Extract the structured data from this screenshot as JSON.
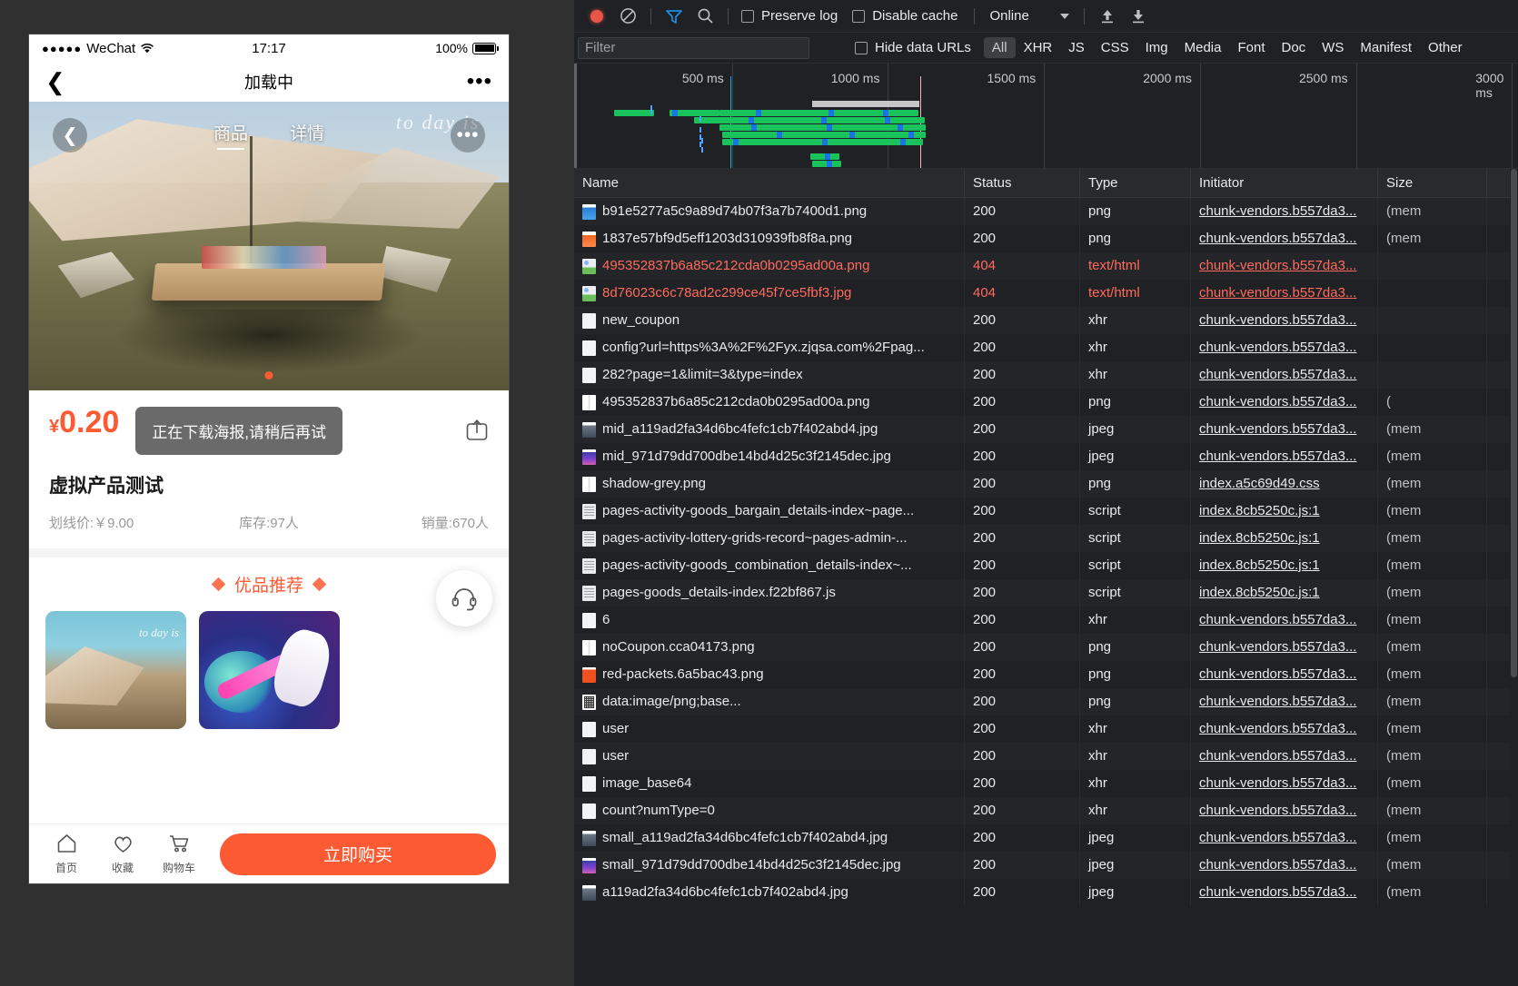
{
  "phone": {
    "status_bar": {
      "signal_dots": "●●●●●",
      "carrier": "WeChat",
      "wifi_icon": "wifi-icon",
      "time": "17:17",
      "battery_percent": "100%"
    },
    "nav": {
      "back_icon": "chevron-left-icon",
      "title": "加载中",
      "more_icon": "more-horizontal-icon"
    },
    "hero": {
      "back_icon": "chevron-left-icon",
      "more_icon": "more-horizontal-icon",
      "tabs": [
        {
          "label": "商品",
          "active": true
        },
        {
          "label": "详情",
          "active": false
        }
      ],
      "watermark": "to day is"
    },
    "product": {
      "currency": "¥",
      "price": "0.20",
      "toast": "正在下载海报,请稍后再试",
      "share_icon": "share-icon",
      "title": "虚拟产品测试",
      "original_price_label": "划线价:￥9.00",
      "stock_label": "库存:97人",
      "sales_label": "销量:670人"
    },
    "recommend": {
      "heading": "优品推荐",
      "diamond_icon": "diamond-icon",
      "service_icon": "headset-icon",
      "card_1_caption": "to day is"
    },
    "bottom": {
      "nav": [
        {
          "icon": "home-icon",
          "label": "首页"
        },
        {
          "icon": "heart-icon",
          "label": "收藏"
        },
        {
          "icon": "cart-icon",
          "label": "购物车"
        }
      ],
      "buy_label": "立即购买"
    }
  },
  "devtools": {
    "toolbar": {
      "record_icon": "record-dot-icon",
      "clear_icon": "clear-icon",
      "filter_icon": "funnel-icon",
      "search_icon": "search-icon",
      "preserve_log_label": "Preserve log",
      "disable_cache_label": "Disable cache",
      "throttle_value": "Online",
      "caret_icon": "chevron-down-icon",
      "import_icon": "upload-arrow-icon",
      "export_icon": "download-arrow-icon"
    },
    "filterbar": {
      "filter_placeholder": "Filter",
      "filter_value": "",
      "hide_data_urls_label": "Hide data URLs",
      "types": [
        "All",
        "XHR",
        "JS",
        "CSS",
        "Img",
        "Media",
        "Font",
        "Doc",
        "WS",
        "Manifest",
        "Other"
      ],
      "active_type": "All"
    },
    "overview": {
      "ticks": [
        "500 ms",
        "1000 ms",
        "1500 ms",
        "2000 ms",
        "2500 ms",
        "3000 ms"
      ]
    },
    "columns": [
      "Name",
      "Status",
      "Type",
      "Initiator",
      "Size"
    ],
    "rows": [
      {
        "icon": "image-blue-icon",
        "name": "b91e5277a5c9a89d74b07f3a7b7400d1.png",
        "status": "200",
        "type": "png",
        "initiator": "chunk-vendors.b557da3...",
        "size": "(mem",
        "error": false
      },
      {
        "icon": "image-orange-icon",
        "name": "1837e57bf9d5eff1203d310939fb8f8a.png",
        "status": "200",
        "type": "png",
        "initiator": "chunk-vendors.b557da3...",
        "size": "(mem",
        "error": false
      },
      {
        "icon": "image-broken-icon",
        "name": "495352837b6a85c212cda0b0295ad00a.png",
        "status": "404",
        "type": "text/html",
        "initiator": "chunk-vendors.b557da3...",
        "size": "",
        "error": true
      },
      {
        "icon": "image-broken-icon",
        "name": "8d76023c6c78ad2c299ce45f7ce5fbf3.jpg",
        "status": "404",
        "type": "text/html",
        "initiator": "chunk-vendors.b557da3...",
        "size": "",
        "error": true
      },
      {
        "icon": "doc-icon",
        "name": "new_coupon",
        "status": "200",
        "type": "xhr",
        "initiator": "chunk-vendors.b557da3...",
        "size": "",
        "error": false
      },
      {
        "icon": "doc-icon",
        "name": "config?url=https%3A%2F%2Fyx.zjqsa.com%2Fpag...",
        "status": "200",
        "type": "xhr",
        "initiator": "chunk-vendors.b557da3...",
        "size": "",
        "error": false
      },
      {
        "icon": "doc-icon",
        "name": "282?page=1&limit=3&type=index",
        "status": "200",
        "type": "xhr",
        "initiator": "chunk-vendors.b557da3...",
        "size": "",
        "error": false
      },
      {
        "icon": "image-grey-icon",
        "name": "495352837b6a85c212cda0b0295ad00a.png",
        "status": "200",
        "type": "png",
        "initiator": "chunk-vendors.b557da3...",
        "size": "(",
        "error": false
      },
      {
        "icon": "image-photo-icon",
        "name": "mid_a119ad2fa34d6bc4fefc1cb7f402abd4.jpg",
        "status": "200",
        "type": "jpeg",
        "initiator": "chunk-vendors.b557da3...",
        "size": "(mem",
        "error": false
      },
      {
        "icon": "image-space-icon",
        "name": "mid_971d79dd700dbe14bd4d25c3f2145dec.jpg",
        "status": "200",
        "type": "jpeg",
        "initiator": "chunk-vendors.b557da3...",
        "size": "(mem",
        "error": false
      },
      {
        "icon": "image-shadow-icon",
        "name": "shadow-grey.png",
        "status": "200",
        "type": "png",
        "initiator": "index.a5c69d49.css",
        "size": "(mem",
        "error": false
      },
      {
        "icon": "script-icon",
        "name": "pages-activity-goods_bargain_details-index~page...",
        "status": "200",
        "type": "script",
        "initiator": "index.8cb5250c.js:1",
        "size": "(mem",
        "error": false
      },
      {
        "icon": "script-icon",
        "name": "pages-activity-lottery-grids-record~pages-admin-...",
        "status": "200",
        "type": "script",
        "initiator": "index.8cb5250c.js:1",
        "size": "(mem",
        "error": false
      },
      {
        "icon": "script-icon",
        "name": "pages-activity-goods_combination_details-index~...",
        "status": "200",
        "type": "script",
        "initiator": "index.8cb5250c.js:1",
        "size": "(mem",
        "error": false
      },
      {
        "icon": "script-icon",
        "name": "pages-goods_details-index.f22bf867.js",
        "status": "200",
        "type": "script",
        "initiator": "index.8cb5250c.js:1",
        "size": "(mem",
        "error": false
      },
      {
        "icon": "doc-icon",
        "name": "6",
        "status": "200",
        "type": "xhr",
        "initiator": "chunk-vendors.b557da3...",
        "size": "(mem",
        "error": false
      },
      {
        "icon": "image-grey-icon",
        "name": "noCoupon.cca04173.png",
        "status": "200",
        "type": "png",
        "initiator": "chunk-vendors.b557da3...",
        "size": "(mem",
        "error": false
      },
      {
        "icon": "image-red-icon",
        "name": "red-packets.6a5bac43.png",
        "status": "200",
        "type": "png",
        "initiator": "chunk-vendors.b557da3...",
        "size": "(mem",
        "error": false
      },
      {
        "icon": "image-qr-icon",
        "name": "data:image/png;base...",
        "status": "200",
        "type": "png",
        "initiator": "chunk-vendors.b557da3...",
        "size": "(mem",
        "error": false
      },
      {
        "icon": "doc-icon",
        "name": "user",
        "status": "200",
        "type": "xhr",
        "initiator": "chunk-vendors.b557da3...",
        "size": "(mem",
        "error": false
      },
      {
        "icon": "doc-icon",
        "name": "user",
        "status": "200",
        "type": "xhr",
        "initiator": "chunk-vendors.b557da3...",
        "size": "(mem",
        "error": false
      },
      {
        "icon": "doc-icon",
        "name": "image_base64",
        "status": "200",
        "type": "xhr",
        "initiator": "chunk-vendors.b557da3...",
        "size": "(mem",
        "error": false
      },
      {
        "icon": "doc-icon",
        "name": "count?numType=0",
        "status": "200",
        "type": "xhr",
        "initiator": "chunk-vendors.b557da3...",
        "size": "(mem",
        "error": false
      },
      {
        "icon": "image-photo-icon",
        "name": "small_a119ad2fa34d6bc4fefc1cb7f402abd4.jpg",
        "status": "200",
        "type": "jpeg",
        "initiator": "chunk-vendors.b557da3...",
        "size": "(mem",
        "error": false
      },
      {
        "icon": "image-space-icon",
        "name": "small_971d79dd700dbe14bd4d25c3f2145dec.jpg",
        "status": "200",
        "type": "jpeg",
        "initiator": "chunk-vendors.b557da3...",
        "size": "(mem",
        "error": false
      },
      {
        "icon": "image-photo-icon",
        "name": "a119ad2fa34d6bc4fefc1cb7f402abd4.jpg",
        "status": "200",
        "type": "jpeg",
        "initiator": "chunk-vendors.b557da3...",
        "size": "(mem",
        "error": false
      }
    ]
  },
  "colors": {
    "accent": "#fb5a32",
    "error": "#ff6b5e",
    "record": "#e8564a",
    "waterfall_green": "#19c25b",
    "waterfall_blue": "#1a73e8",
    "devtools_bg": "#202124"
  }
}
